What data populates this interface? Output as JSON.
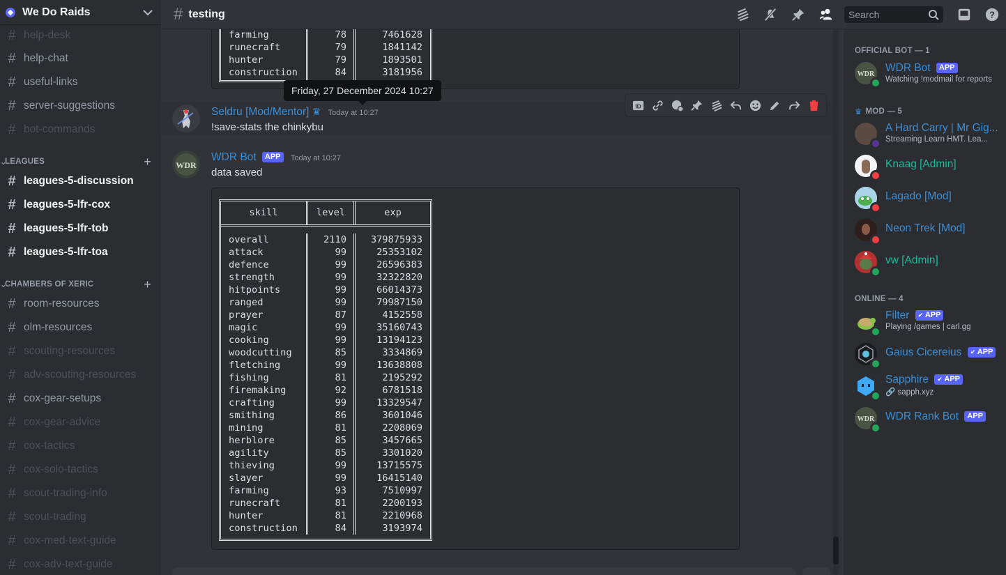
{
  "server": {
    "name": "We Do Raids"
  },
  "channels_top": [
    {
      "name": "help-desk",
      "state": "muted"
    },
    {
      "name": "help-chat",
      "state": "normal"
    },
    {
      "name": "useful-links",
      "state": "normal"
    },
    {
      "name": "server-suggestions",
      "state": "normal"
    },
    {
      "name": "bot-commands",
      "state": "muted"
    }
  ],
  "categories": [
    {
      "label": "LEAGUES",
      "channels": [
        {
          "name": "leagues-5-discussion",
          "state": "unread"
        },
        {
          "name": "leagues-5-lfr-cox",
          "state": "unread"
        },
        {
          "name": "leagues-5-lfr-tob",
          "state": "unread"
        },
        {
          "name": "leagues-5-lfr-toa",
          "state": "unread"
        }
      ]
    },
    {
      "label": "CHAMBERS OF XERIC",
      "channels": [
        {
          "name": "room-resources",
          "state": "normal"
        },
        {
          "name": "olm-resources",
          "state": "normal"
        },
        {
          "name": "scouting-resources",
          "state": "muted"
        },
        {
          "name": "adv-scouting-resources",
          "state": "muted"
        },
        {
          "name": "cox-gear-setups",
          "state": "normal"
        },
        {
          "name": "cox-gear-advice",
          "state": "muted"
        },
        {
          "name": "cox-tactics",
          "state": "muted"
        },
        {
          "name": "cox-solo-tactics",
          "state": "muted"
        },
        {
          "name": "scout-trading-info",
          "state": "muted"
        },
        {
          "name": "scout-trading",
          "state": "muted"
        },
        {
          "name": "cox-med-text-guide",
          "state": "muted"
        },
        {
          "name": "cox-adv-text-guide",
          "state": "muted"
        }
      ]
    }
  ],
  "topbar": {
    "channel": "testing",
    "search_placeholder": "Search"
  },
  "tooltip": "Friday, 27 December 2024 10:27",
  "prev_table_tail": [
    [
      "farming",
      "78",
      "7461628"
    ],
    [
      "runecraft",
      "79",
      "1841142"
    ],
    [
      "hunter",
      "79",
      "1893501"
    ],
    [
      "construction",
      "84",
      "3181956"
    ]
  ],
  "messages": [
    {
      "author": "Seldru [Mod/Mentor]",
      "time": "Today at 10:27",
      "text": "!save-stats the chinkybu"
    },
    {
      "author": "WDR Bot",
      "tag": "APP",
      "time": "Today at 10:27",
      "text": "data saved"
    }
  ],
  "stats_table": {
    "headers": [
      "skill",
      "level",
      "exp"
    ],
    "rows": [
      [
        "overall",
        "2110",
        "379875933"
      ],
      [
        "attack",
        "99",
        "25353102"
      ],
      [
        "defence",
        "99",
        "26596383"
      ],
      [
        "strength",
        "99",
        "32322820"
      ],
      [
        "hitpoints",
        "99",
        "66014373"
      ],
      [
        "ranged",
        "99",
        "79987150"
      ],
      [
        "prayer",
        "87",
        "4152558"
      ],
      [
        "magic",
        "99",
        "35160743"
      ],
      [
        "cooking",
        "99",
        "13194123"
      ],
      [
        "woodcutting",
        "85",
        "3334869"
      ],
      [
        "fletching",
        "99",
        "13638808"
      ],
      [
        "fishing",
        "81",
        "2195292"
      ],
      [
        "firemaking",
        "92",
        "6781518"
      ],
      [
        "crafting",
        "99",
        "13329547"
      ],
      [
        "smithing",
        "86",
        "3601046"
      ],
      [
        "mining",
        "81",
        "2208069"
      ],
      [
        "herblore",
        "85",
        "3457665"
      ],
      [
        "agility",
        "85",
        "3301020"
      ],
      [
        "thieving",
        "99",
        "13715575"
      ],
      [
        "slayer",
        "99",
        "16415140"
      ],
      [
        "farming",
        "93",
        "7510997"
      ],
      [
        "runecraft",
        "81",
        "2200193"
      ],
      [
        "hunter",
        "81",
        "2210968"
      ],
      [
        "construction",
        "84",
        "3193974"
      ]
    ]
  },
  "members": {
    "official_bot_label": "OFFICIAL BOT — 1",
    "mod_label": "MOD — 5",
    "online_label": "ONLINE — 4",
    "official_bot": [
      {
        "name": "WDR Bot",
        "tag": "APP",
        "sub": "Watching !modmail for reports",
        "color": "#3b8ed6"
      }
    ],
    "mods": [
      {
        "name": "A Hard Carry | Mr Gig...",
        "sub": "Streaming Learn HMT. Lea...",
        "color": "#3b8ed6",
        "status": "streaming"
      },
      {
        "name": "Knaag [Admin]",
        "color": "#1abc9c",
        "status": "dnd"
      },
      {
        "name": "Lagado [Mod]",
        "color": "#3b8ed6",
        "status": "dnd"
      },
      {
        "name": "Neon Trek [Mod]",
        "color": "#3b8ed6",
        "status": "dnd"
      },
      {
        "name": "vw [Admin]",
        "color": "#1abc9c",
        "status": "online"
      }
    ],
    "online": [
      {
        "name": "Filter",
        "tag": "APP",
        "sub": "Playing /games | carl.gg",
        "color": "#3b8ed6"
      },
      {
        "name": "Gaius Cicereius",
        "tag": "APP",
        "color": "#3b8ed6"
      },
      {
        "name": "Sapphire",
        "tag": "APP",
        "sub": "sapph.xyz",
        "color": "#3b8ed6"
      },
      {
        "name": "WDR Rank Bot",
        "tag": "APP",
        "color": "#3b8ed6"
      }
    ]
  }
}
